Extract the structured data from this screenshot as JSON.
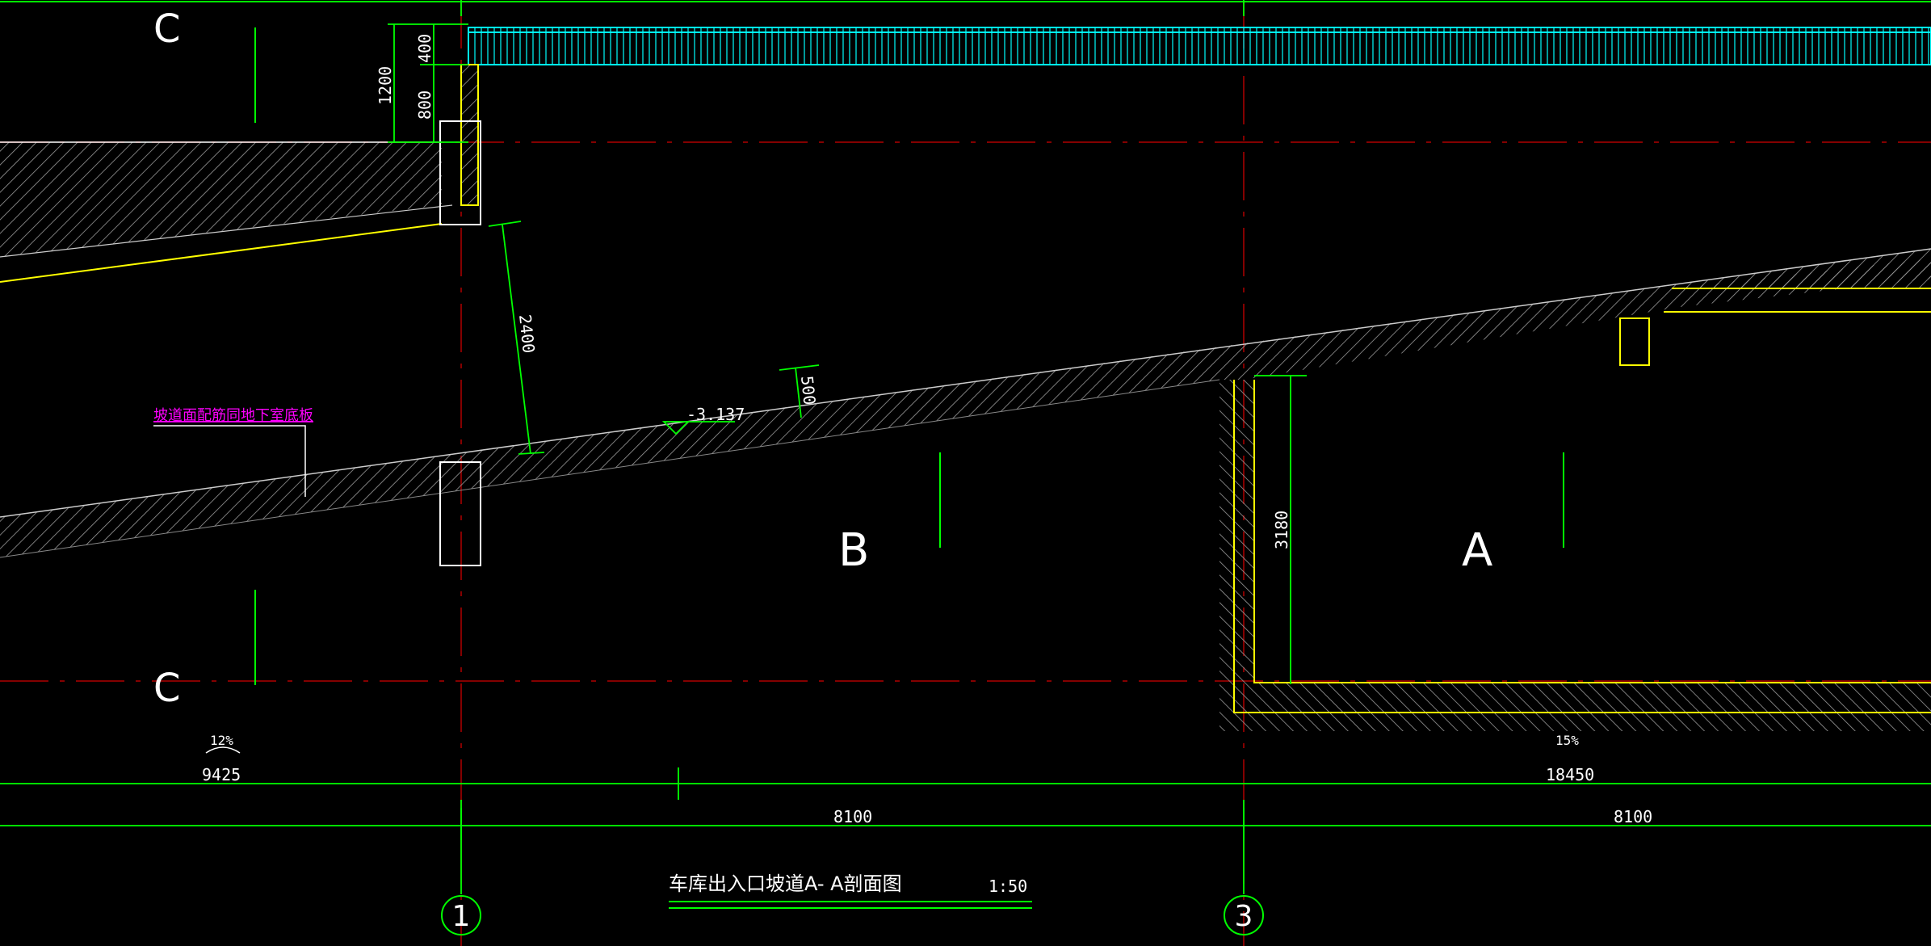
{
  "drawing": {
    "title": "车库出入口坡道A- A剖面图",
    "scale": "1:50",
    "section_marks": {
      "top": "C",
      "bottom": "C"
    },
    "room_labels": {
      "left": "B",
      "right": "A"
    },
    "axis_bubbles": [
      "1",
      "3"
    ],
    "dimensions": {
      "d400": "400",
      "d800": "800",
      "d1200": "1200",
      "d2400": "2400",
      "d500": "500",
      "d3180": "3180",
      "total_right": "18450",
      "total_left": "9425",
      "bay_left": "8100",
      "bay_right": "8100"
    },
    "elevation": "-3.137",
    "slopes": {
      "left": "12%",
      "right": "15%"
    },
    "note": "坡道面配筋同地下室底板"
  },
  "colors": {
    "background": "#000000",
    "dimension_green": "#00ff00",
    "outline_white": "#ffffff",
    "slab_yellow": "#ffff00",
    "grid_red": "#ff0000",
    "railing_cyan": "#00ffff",
    "note_magenta": "#ff00ff"
  }
}
